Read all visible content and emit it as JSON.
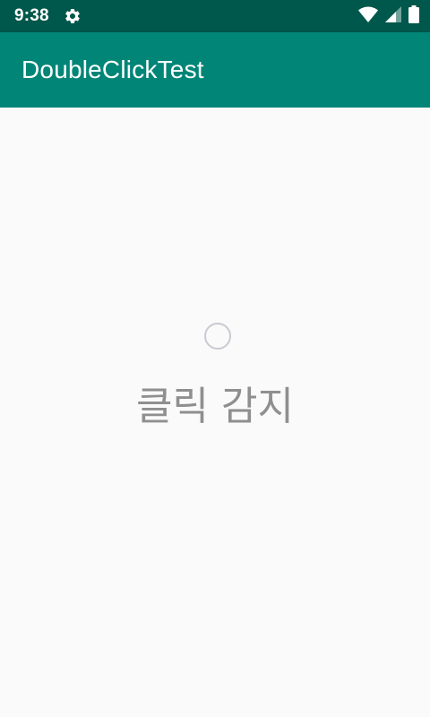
{
  "status_bar": {
    "time": "9:38",
    "icons": [
      "settings-gear-icon",
      "wifi-icon",
      "cell-signal-icon",
      "battery-icon"
    ]
  },
  "app_bar": {
    "title": "DoubleClickTest"
  },
  "main": {
    "radio_checked": false,
    "label": "클릭 감지"
  },
  "colors": {
    "status_bar": "#00574b",
    "app_bar": "#008577",
    "background": "#fafafa",
    "label_text": "#8f8f8f",
    "radio_outline": "#c9cad3"
  }
}
